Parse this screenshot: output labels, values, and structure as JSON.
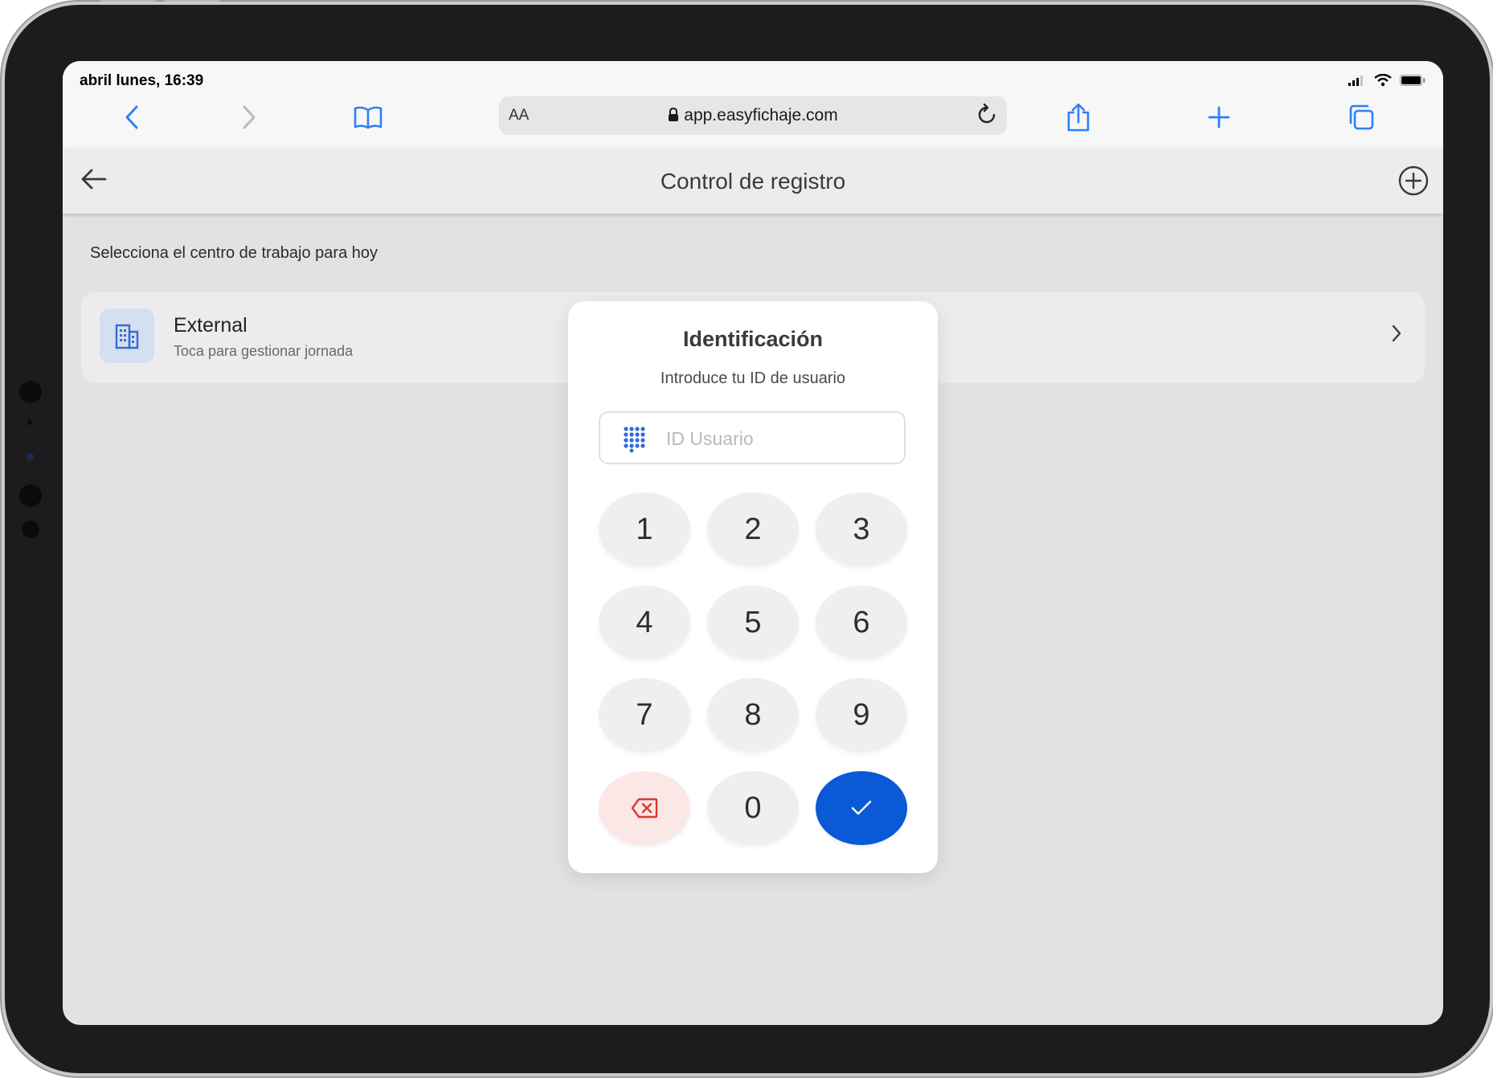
{
  "status_bar": {
    "time": "abril lunes, 16:39"
  },
  "browser": {
    "aa_label": "AA",
    "url": "app.easyfichaje.com"
  },
  "header": {
    "title": "Control de registro"
  },
  "main": {
    "section_label": "Selecciona el centro de trabajo para hoy",
    "work_center": {
      "name": "External",
      "subtitle": "Toca para gestionar jornada"
    }
  },
  "modal": {
    "title": "Identificación",
    "subtitle": "Introduce tu ID de usuario",
    "input_placeholder": "ID Usuario",
    "input_value": "",
    "keys": [
      "1",
      "2",
      "3",
      "4",
      "5",
      "6",
      "7",
      "8",
      "9",
      "0"
    ]
  },
  "colors": {
    "confirm_button": "#0a59d6",
    "delete_button_bg": "#fbe7e6",
    "delete_icon": "#d9372f",
    "browser_accent": "#2f7ff5"
  },
  "icons": {
    "back": "chevron-left-icon",
    "forward": "chevron-right-icon",
    "bookmarks": "book-icon",
    "lock": "lock-icon",
    "reload": "reload-icon",
    "share": "share-icon",
    "new_tab": "plus-icon",
    "tabs": "tabs-icon",
    "app_back": "arrow-left-icon",
    "app_add": "plus-circle-icon",
    "building": "building-icon",
    "keypad": "keypad-icon",
    "backspace": "backspace-icon",
    "confirm": "check-icon"
  }
}
